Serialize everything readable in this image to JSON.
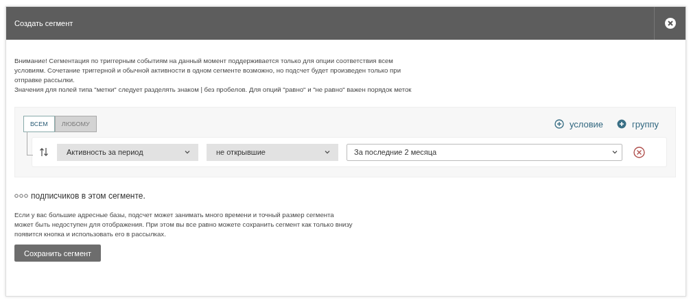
{
  "dialog": {
    "title": "Создать сегмент"
  },
  "notice": [
    "Внимание! Сегментация по триггерным событиям на данный момент поддерживается только для опции соответствия всем условиям. Сочетание триггерной и обычной активности в одном сегменте возможно, но подсчет будет произведен только при отправке рассылки.",
    "Значения для полей типа \"метки\" следует разделять знаком | без пробелов. Для опций \"равно\" и \"не равно\" важен порядок меток"
  ],
  "match_tabs": [
    {
      "label": "ВСЕМ",
      "selected": true
    },
    {
      "label": "ЛЮБОМУ",
      "selected": false
    }
  ],
  "actions": [
    {
      "label": "условие",
      "kind": "outline"
    },
    {
      "label": "группу",
      "kind": "filled"
    }
  ],
  "conditions": [
    {
      "fields": [
        {
          "value": "Активность за период",
          "kind": "gray"
        },
        {
          "value": "не открывшие",
          "kind": "gray"
        },
        {
          "value": "За последние 2 месяца",
          "kind": "white"
        }
      ]
    }
  ],
  "count_text": "подписчиков в этом сегменте.",
  "hint": "Если у вас большие адресные базы, подсчет может занимать много времени и точный размер сегмента может быть недоступен для отображения. При этом вы все равно можете сохранить сегмент как только внизу появится кнопка и использовать его в рассылках.",
  "save_button": "Сохранить сегмент"
}
